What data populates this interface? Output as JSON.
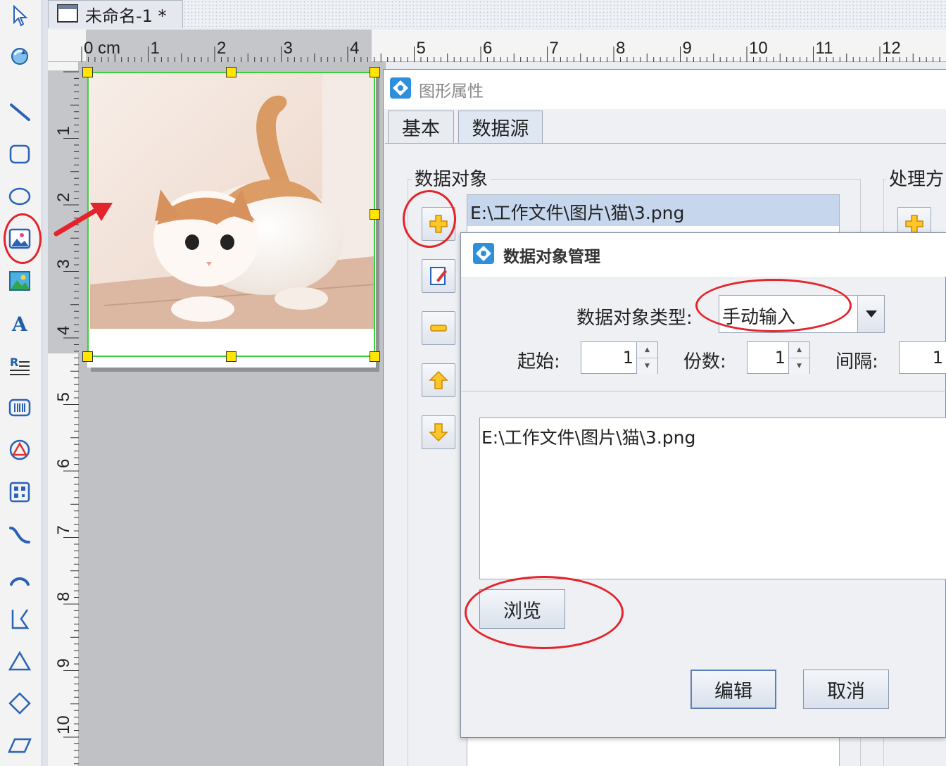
{
  "document_tab": {
    "title": "未命名-1 *"
  },
  "ruler": {
    "top_labels": [
      "0 cm",
      "1",
      "2",
      "3",
      "4",
      "5",
      "6",
      "7",
      "8",
      "9",
      "10",
      "11",
      "12"
    ],
    "left_labels": [
      "1",
      "2",
      "3",
      "4",
      "5",
      "6",
      "7",
      "8",
      "9",
      "10"
    ]
  },
  "toolbar": {
    "tools": [
      "select-arrow-icon",
      "rotate-icon",
      "line-icon",
      "rounded-rect-icon",
      "ellipse-icon",
      "image-icon",
      "image-alt-icon",
      "text-icon",
      "rich-text-icon",
      "barcode-icon",
      "triangle-symbol-icon",
      "qrcode-icon",
      "curve-icon",
      "arc-icon",
      "polyline-icon",
      "triangle-icon",
      "diamond-icon",
      "parallelogram-icon"
    ]
  },
  "properties_dialog": {
    "title": "图形属性",
    "tabs": [
      "基本",
      "数据源"
    ],
    "active_tab": "数据源",
    "data_object_group": "数据对象",
    "processing_group": "处理方",
    "data_objects": [
      "E:\\工作文件\\图片\\猫\\3.png"
    ]
  },
  "data_object_dialog": {
    "title": "数据对象管理",
    "type_label": "数据对象类型:",
    "type_value": "手动输入",
    "start_label": "起始:",
    "start_value": "1",
    "copies_label": "份数:",
    "copies_value": "1",
    "interval_label": "间隔:",
    "interval_value": "1",
    "content": "E:\\工作文件\\图片\\猫\\3.png",
    "browse_label": "浏览",
    "edit_label": "编辑",
    "cancel_label": "取消"
  },
  "colors": {
    "annotation_red": "#e3242b",
    "selection_green": "#3ad13a",
    "handle_yellow": "#ffe500"
  }
}
